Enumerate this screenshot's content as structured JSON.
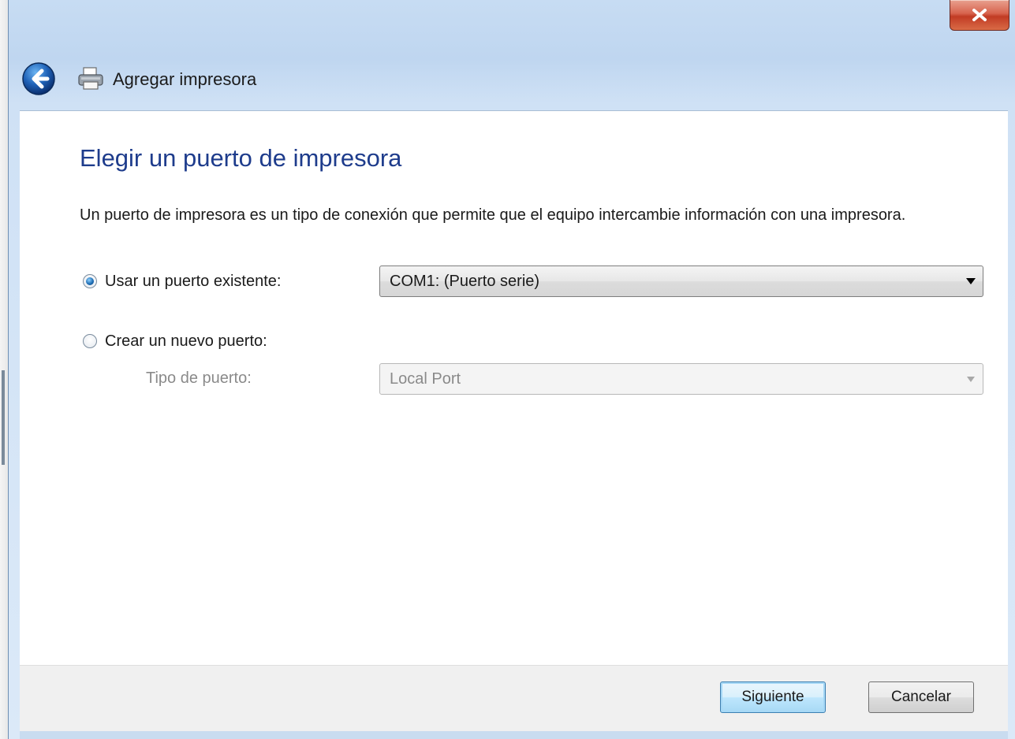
{
  "window": {
    "title": "Agregar impresora",
    "close_label": "x"
  },
  "page": {
    "heading": "Elegir un puerto de impresora",
    "description": "Un puerto de impresora es un tipo de conexión que permite que el equipo intercambie información con una impresora."
  },
  "options": {
    "existing_port": {
      "label": "Usar un puerto existente:",
      "selected": true,
      "value": "COM1: (Puerto serie)"
    },
    "new_port": {
      "label": "Crear un nuevo puerto:",
      "selected": false,
      "type_label": "Tipo de puerto:",
      "type_value": "Local Port"
    }
  },
  "buttons": {
    "next": "Siguiente",
    "cancel": "Cancelar"
  },
  "colors": {
    "heading": "#1e3c8c",
    "title_bar": "#c7dcf3",
    "close_button": "#c13b24",
    "default_button_border": "#3c7fb1"
  },
  "icons": {
    "back": "back-arrow-icon",
    "printer": "printer-icon",
    "close": "close-icon",
    "dropdown": "chevron-down-icon"
  }
}
